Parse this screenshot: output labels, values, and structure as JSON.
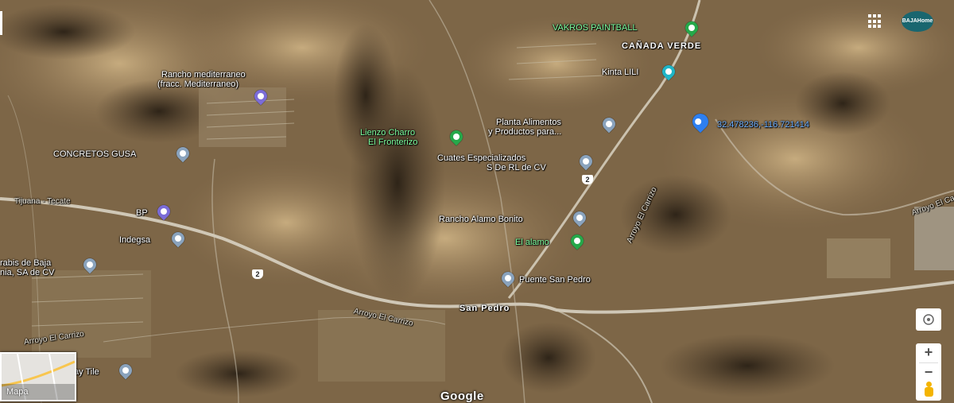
{
  "map": {
    "place_labels": [
      {
        "id": "vakros",
        "text": "VAKROS PAINTBALL",
        "style": "green"
      },
      {
        "id": "canada",
        "text": "CAÑADA VERDE",
        "style": "bold"
      },
      {
        "id": "kinta",
        "text": "Kinta LILI",
        "style": "white"
      },
      {
        "id": "rancho_med_1",
        "text": "Rancho mediterraneo",
        "style": "white"
      },
      {
        "id": "rancho_med_2",
        "text": "(fracc. Mediterraneo)",
        "style": "white"
      },
      {
        "id": "planta_1",
        "text": "Planta Alimentos",
        "style": "white"
      },
      {
        "id": "planta_2",
        "text": "y Productos para...",
        "style": "white"
      },
      {
        "id": "coords",
        "text": "32.478236,-116.721414",
        "style": "blue"
      },
      {
        "id": "lienzo_1",
        "text": "Lienzo Charro",
        "style": "green"
      },
      {
        "id": "lienzo_2",
        "text": "El Fronterizo",
        "style": "green"
      },
      {
        "id": "concretos",
        "text": "CONCRETOS GUSA",
        "style": "white"
      },
      {
        "id": "cuates_1",
        "text": "Cuates Especializados",
        "style": "white"
      },
      {
        "id": "cuates_2",
        "text": "S De RL de CV",
        "style": "white"
      },
      {
        "id": "tijuana",
        "text": "Tijuana - Tecate",
        "style": "road"
      },
      {
        "id": "bp",
        "text": "BP",
        "style": "white"
      },
      {
        "id": "rancho_alamo",
        "text": "Rancho Alamo Bonito",
        "style": "white"
      },
      {
        "id": "el_alamo",
        "text": "El alamo",
        "style": "green"
      },
      {
        "id": "indegsa",
        "text": "Indegsa",
        "style": "white"
      },
      {
        "id": "arabis_1",
        "text": "rabis de Baja",
        "style": "white"
      },
      {
        "id": "arabis_2",
        "text": "nia, SA de CV",
        "style": "white"
      },
      {
        "id": "puente",
        "text": "Puente San Pedro",
        "style": "white"
      },
      {
        "id": "san_pedro",
        "text": "San Pedro",
        "style": "bold"
      },
      {
        "id": "arroyo_1",
        "text": "Arroyo El Carrizo",
        "style": "road"
      },
      {
        "id": "arroyo_2",
        "text": "Arroyo El Carrizo",
        "style": "road"
      },
      {
        "id": "arroyo_3",
        "text": "Arroyo El Carrizo",
        "style": "road"
      },
      {
        "id": "arroyo_4",
        "text": "Arroyo El Carrizo",
        "style": "road"
      },
      {
        "id": "tile",
        "text": "ay Tile",
        "style": "white"
      }
    ],
    "road_shield": "2",
    "minimap_label": "Mapa",
    "brand_text": "BAJAHome",
    "google_logo": "Google",
    "zoom_in": "+",
    "zoom_out": "−",
    "colors": {
      "terrain_dark": "#5c4630",
      "terrain_light": "#b59a70",
      "road": "#d8d2c2",
      "selected_pin": "#2d7ff0",
      "poi_green": "#26a84a"
    }
  }
}
